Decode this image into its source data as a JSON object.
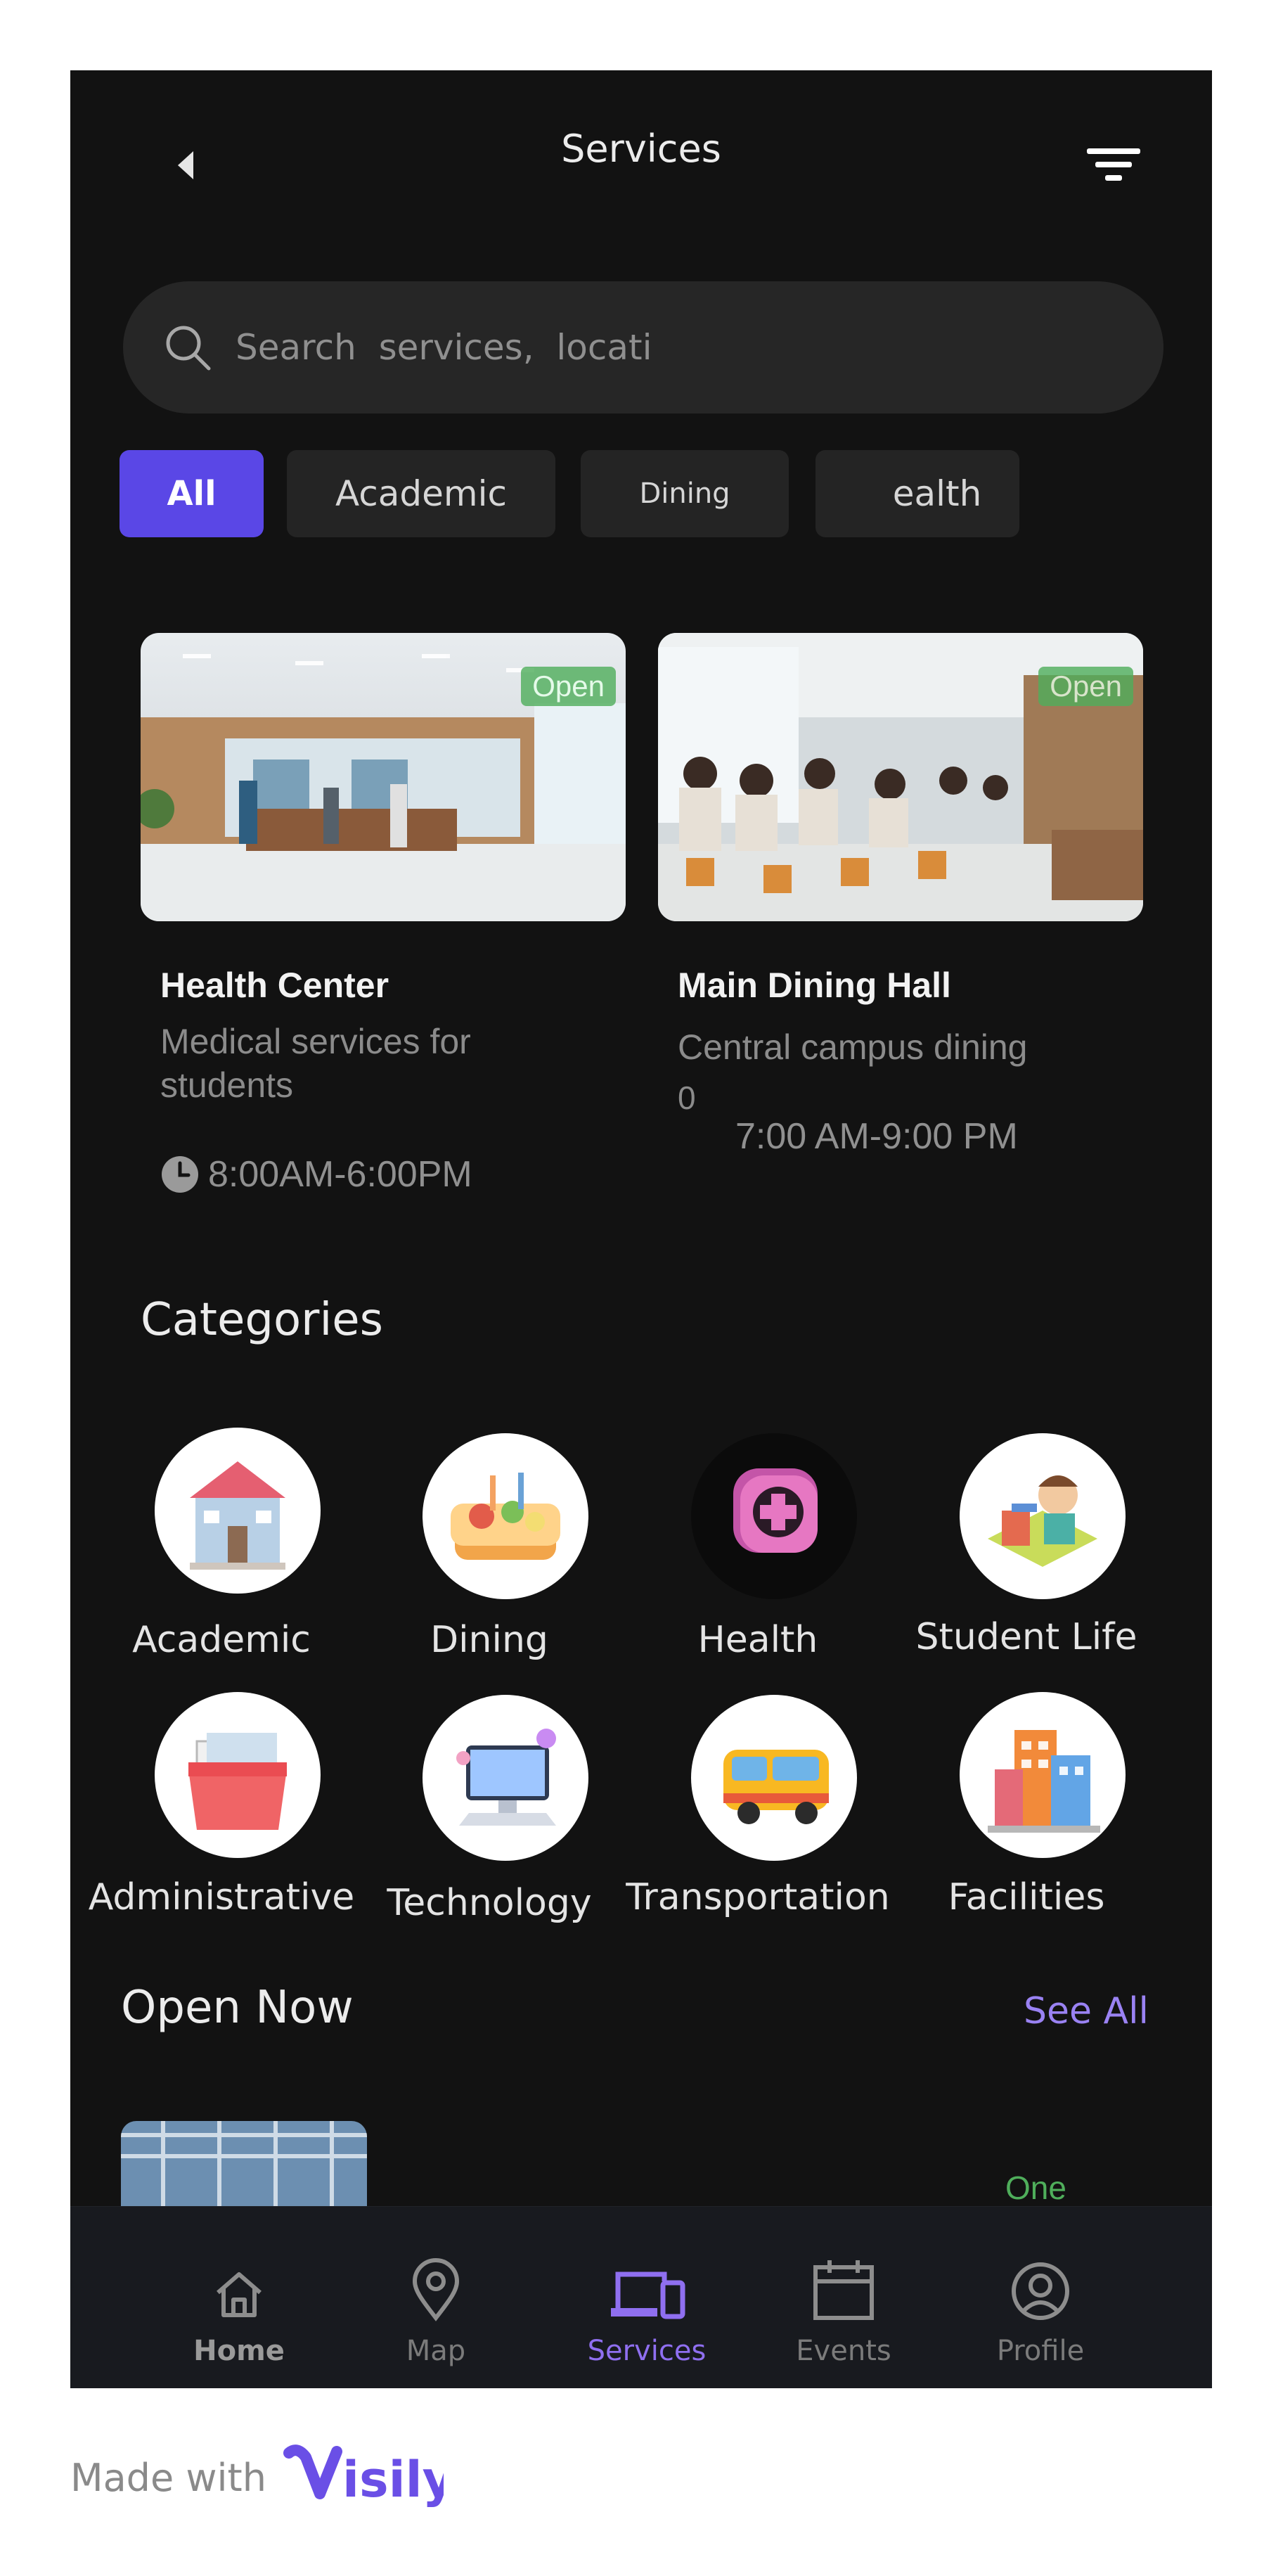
{
  "header": {
    "title": "Services"
  },
  "search": {
    "placeholder": "Search  services,  locati"
  },
  "chips": [
    {
      "label": "All",
      "active": true
    },
    {
      "label": "Academic"
    },
    {
      "label": "Dining"
    },
    {
      "label": "ealth"
    }
  ],
  "cards": [
    {
      "name": "Health Center",
      "desc": "Medical services for students",
      "status": "Open",
      "hours": "8:00AM-6:00PM"
    },
    {
      "name": "Main Dining Hall",
      "desc": "Central campus dining",
      "desc_extra": "0",
      "status": "Open",
      "hours": "7:00 AM-9:00 PM"
    }
  ],
  "categories_title": "Categories",
  "categories": [
    {
      "label": "Academic",
      "icon": "school-building-icon"
    },
    {
      "label": "Dining",
      "icon": "food-tray-icon"
    },
    {
      "label": "Health",
      "icon": "medical-plus-icon"
    },
    {
      "label": "Student Life",
      "icon": "student-studying-icon"
    },
    {
      "label": "Administrative",
      "icon": "file-box-icon"
    },
    {
      "label": "Technology",
      "icon": "computer-icon"
    },
    {
      "label": "Transportation",
      "icon": "bus-icon"
    },
    {
      "label": "Facilities",
      "icon": "buildings-icon"
    }
  ],
  "open_now": {
    "title": "Open Now",
    "see_all": "See All",
    "partial_status": "One"
  },
  "tabbar": [
    {
      "label": "Home",
      "icon": "home-icon"
    },
    {
      "label": "Map",
      "icon": "map-pin-icon"
    },
    {
      "label": "Services",
      "icon": "devices-icon",
      "active": true
    },
    {
      "label": "Events",
      "icon": "calendar-icon"
    },
    {
      "label": "Profile",
      "icon": "user-circle-icon"
    }
  ],
  "footer": {
    "made_with": "Made with",
    "brand": "Visily"
  },
  "colors": {
    "accent": "#5a47e6",
    "background": "#121212",
    "open_green": "#4fae5b",
    "link": "#9a82f3"
  }
}
